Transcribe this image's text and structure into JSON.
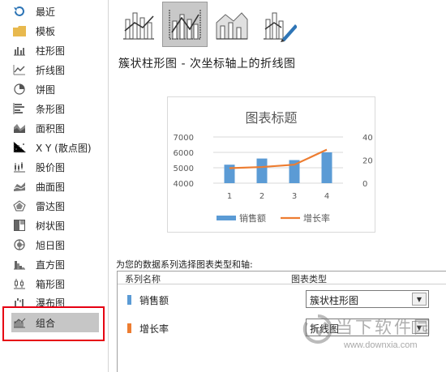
{
  "sidebar": {
    "items": [
      {
        "label": "最近",
        "icon": "recent-icon"
      },
      {
        "label": "模板",
        "icon": "folder-icon"
      },
      {
        "label": "柱形图",
        "icon": "column-chart-icon"
      },
      {
        "label": "折线图",
        "icon": "line-chart-icon"
      },
      {
        "label": "饼图",
        "icon": "pie-chart-icon"
      },
      {
        "label": "条形图",
        "icon": "bar-chart-icon"
      },
      {
        "label": "面积图",
        "icon": "area-chart-icon"
      },
      {
        "label": "X Y (散点图)",
        "icon": "scatter-chart-icon"
      },
      {
        "label": "股价图",
        "icon": "stock-chart-icon"
      },
      {
        "label": "曲面图",
        "icon": "surface-chart-icon"
      },
      {
        "label": "雷达图",
        "icon": "radar-chart-icon"
      },
      {
        "label": "树状图",
        "icon": "treemap-chart-icon"
      },
      {
        "label": "旭日图",
        "icon": "sunburst-chart-icon"
      },
      {
        "label": "直方图",
        "icon": "histogram-chart-icon"
      },
      {
        "label": "箱形图",
        "icon": "box-whisker-chart-icon"
      },
      {
        "label": "瀑布图",
        "icon": "waterfall-chart-icon"
      },
      {
        "label": "组合",
        "icon": "combo-chart-icon",
        "selected": true
      }
    ]
  },
  "subtype_title": "簇状柱形图 - 次坐标轴上的折线图",
  "chart_data": {
    "type": "bar",
    "title": "图表标题",
    "categories": [
      "1",
      "2",
      "3",
      "4"
    ],
    "series": [
      {
        "name": "销售额",
        "type": "bar",
        "axis": "primary",
        "color": "#5b9bd5",
        "values": [
          5200,
          5600,
          5500,
          6000
        ]
      },
      {
        "name": "增长率",
        "type": "line",
        "axis": "secondary",
        "color": "#ed7d31",
        "values": [
          13,
          14,
          16,
          29
        ]
      }
    ],
    "y_primary": {
      "ticks": [
        "7000",
        "6000",
        "5000",
        "4000"
      ],
      "ylim": [
        4000,
        7000
      ]
    },
    "y_secondary": {
      "ticks": [
        "40",
        "20",
        "0"
      ],
      "ylim": [
        0,
        40
      ]
    },
    "grid": true,
    "legend": "bottom"
  },
  "series_section": {
    "caption": "为您的数据系列选择图表类型和轴:",
    "col_series_name": "系列名称",
    "col_chart_type": "图表类型",
    "rows": [
      {
        "name": "销售额",
        "type": "簇状柱形图",
        "color": "#5b9bd5"
      },
      {
        "name": "增长率",
        "type": "折线图",
        "color": "#ed7d31"
      }
    ]
  },
  "watermark": {
    "text": "当下软件园",
    "url": "www.downxia.com"
  }
}
